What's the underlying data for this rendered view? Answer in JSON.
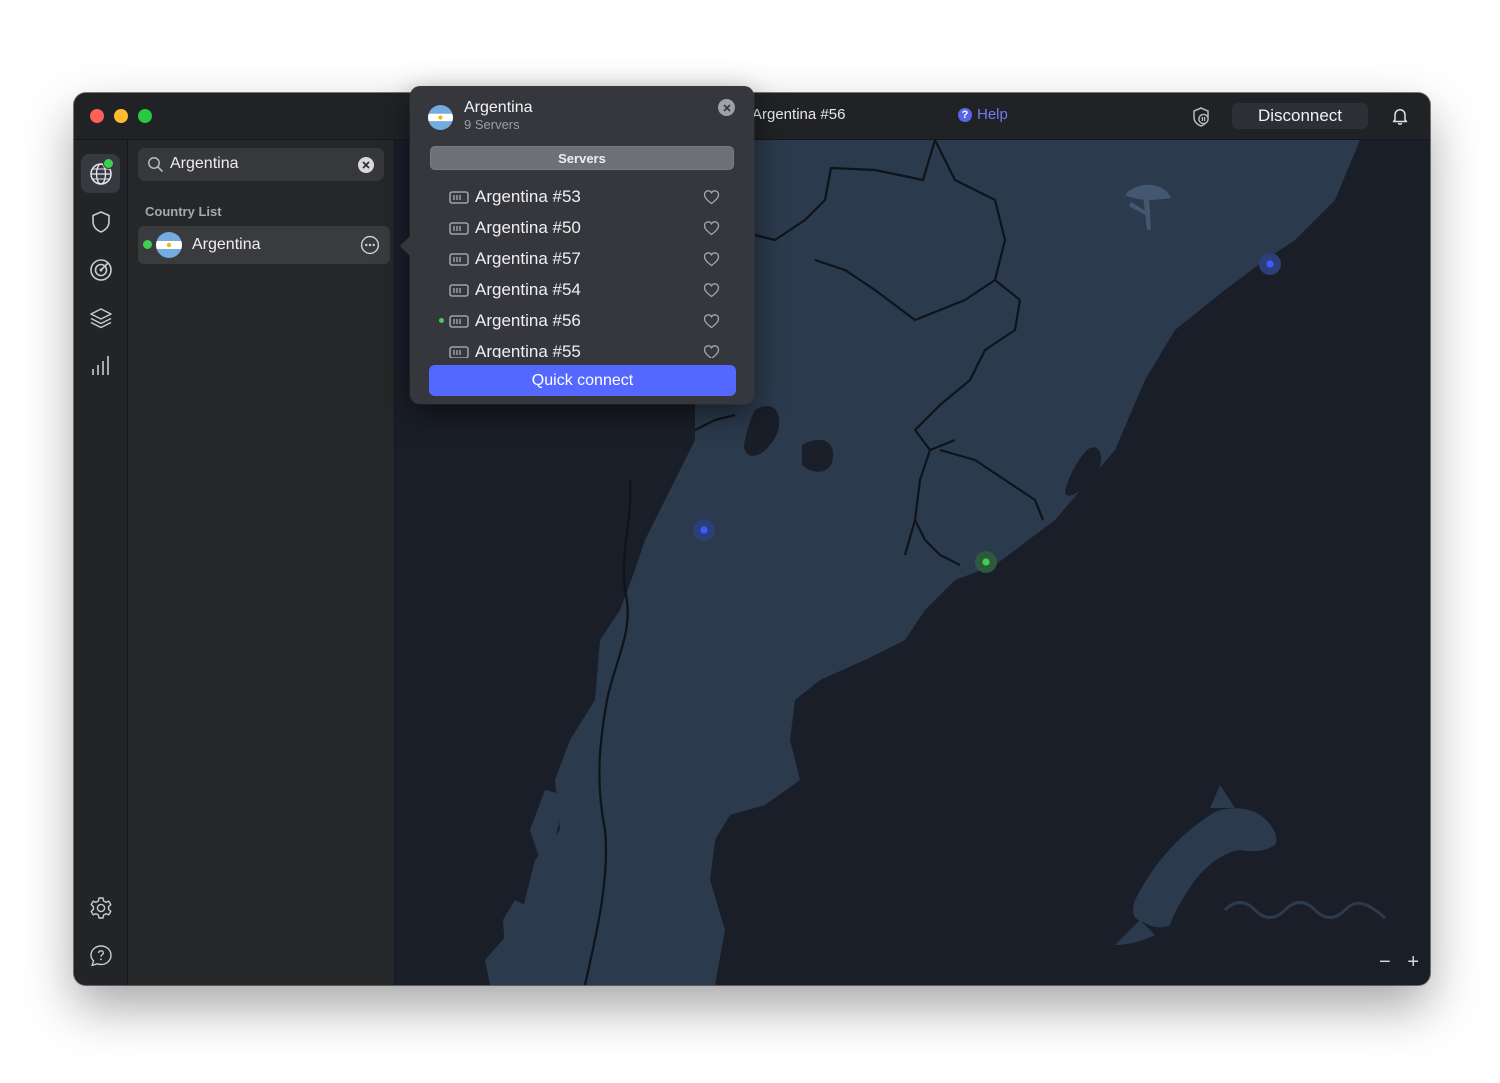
{
  "titlebar": {
    "status_text": "Argentina #56",
    "help_label": "Help",
    "disconnect_label": "Disconnect"
  },
  "sidebar": {
    "search_value": "Argentina",
    "section_label": "Country List",
    "countries": [
      {
        "name": "Argentina",
        "connected": true
      }
    ]
  },
  "popover": {
    "country": "Argentina",
    "server_count": "9 Servers",
    "tab_label": "Servers",
    "servers": [
      {
        "name": "Argentina #53",
        "connected": false
      },
      {
        "name": "Argentina #50",
        "connected": false
      },
      {
        "name": "Argentina #57",
        "connected": false
      },
      {
        "name": "Argentina #54",
        "connected": false
      },
      {
        "name": "Argentina #56",
        "connected": true
      },
      {
        "name": "Argentina #55",
        "connected": false
      }
    ],
    "quick_connect_label": "Quick connect"
  },
  "map": {
    "zoom_out": "−",
    "zoom_in": "+"
  },
  "colors": {
    "accent": "#5468ff",
    "connected": "#3fcf4f",
    "ocean": "#1a1e29",
    "land": "#2c3a4d"
  }
}
